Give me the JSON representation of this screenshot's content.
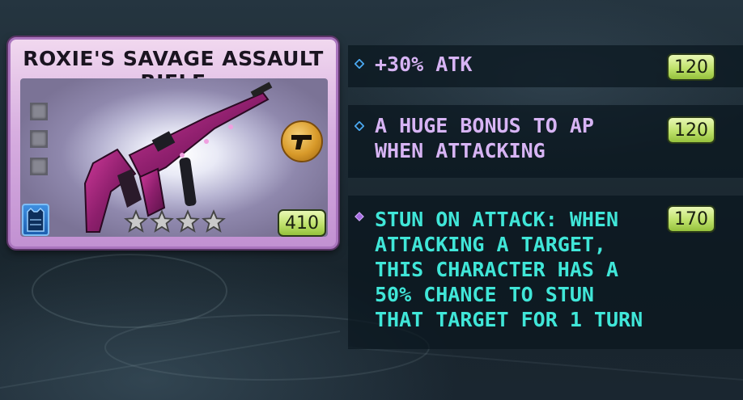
{
  "weapon": {
    "name": "ROXIE'S SAVAGE ASSAULT RIFLE",
    "power": "410",
    "stars": 4,
    "class_icon": "vest-icon",
    "type_icon": "pistol-icon",
    "slots": 3
  },
  "abilities": [
    {
      "text": "+30% ATK",
      "value": "120",
      "bullet": "blue-diamond-outline",
      "color": "#d7b4f4"
    },
    {
      "text": "A HUGE BONUS TO AP WHEN ATTACKING",
      "value": "120",
      "bullet": "blue-diamond-outline",
      "color": "#d7b4f4"
    },
    {
      "text": "STUN ON ATTACK: WHEN ATTACKING A TARGET, THIS CHARACTER HAS A 50% CHANCE TO STUN THAT TARGET FOR 1 TURN",
      "value": "170",
      "bullet": "purple-diamond-filled",
      "color": "#40e6d8"
    }
  ],
  "colors": {
    "card_frame": "#a974bd",
    "badge_green": "#bfe26c",
    "tier_text": "#d7b4f4",
    "special_text": "#40e6d8"
  }
}
